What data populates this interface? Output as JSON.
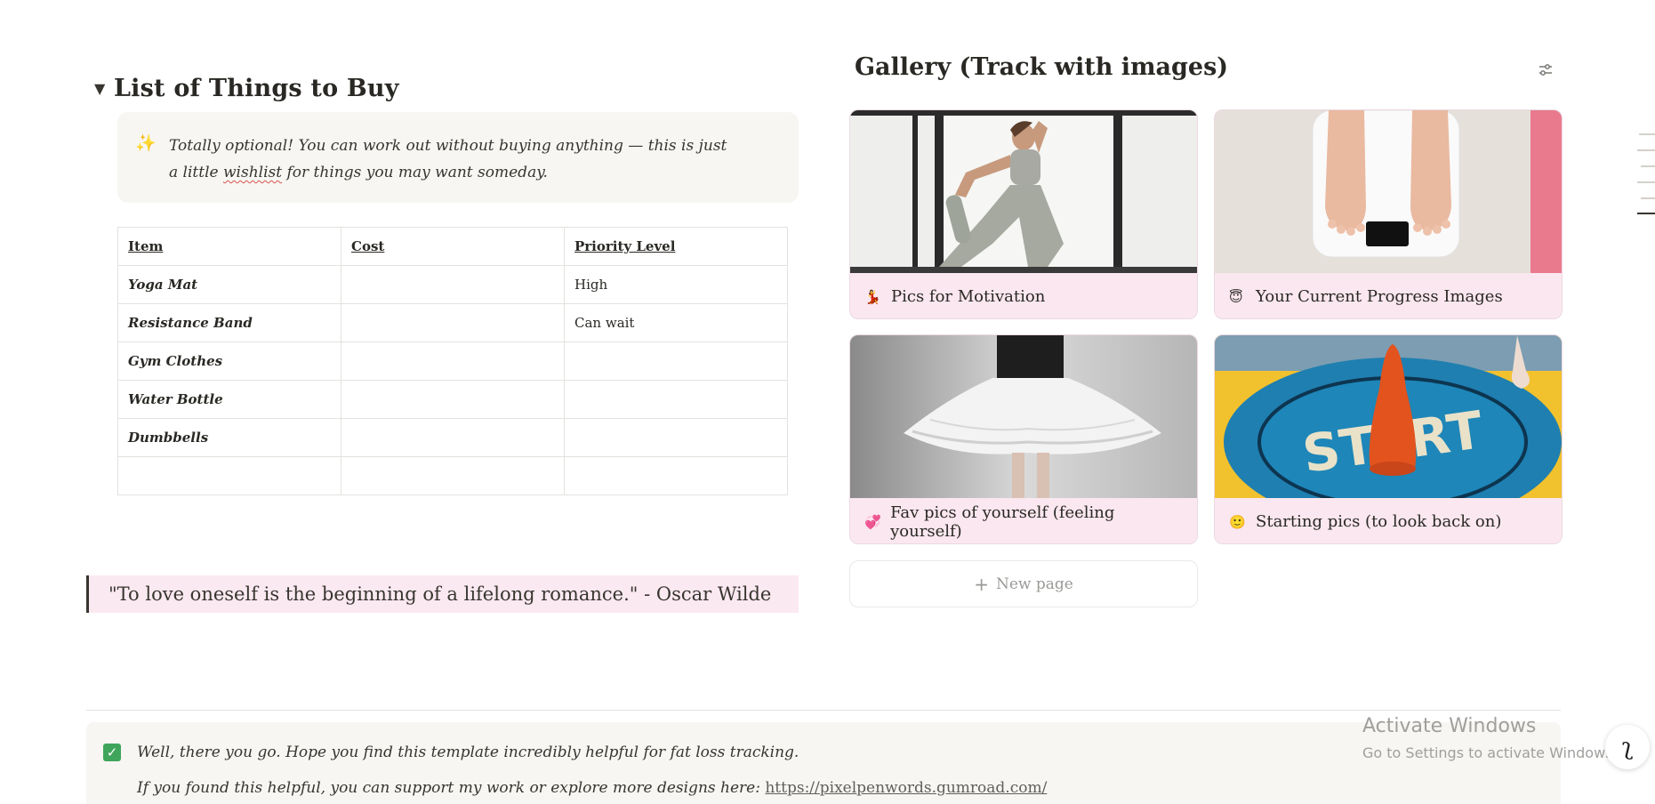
{
  "buy_list": {
    "heading": "List of Things to Buy",
    "callout": {
      "icon": "sparkles-icon",
      "text_before": "Totally optional! You can work out without buying anything — this is just a little ",
      "text_squiggle": "wishlist",
      "text_after": " for things you may want someday."
    },
    "table": {
      "headers": [
        "Item",
        "Cost",
        "Priority Level"
      ],
      "rows": [
        [
          "Yoga Mat",
          "",
          "High"
        ],
        [
          "Resistance Band",
          "",
          "Can wait"
        ],
        [
          "Gym Clothes",
          "",
          ""
        ],
        [
          "Water Bottle",
          "",
          ""
        ],
        [
          "Dumbbells",
          "",
          ""
        ],
        [
          "",
          "",
          ""
        ]
      ]
    }
  },
  "quote": "\"To love oneself is the beginning of a lifelong romance.\" - Oscar Wilde",
  "gallery": {
    "title": "Gallery (Track with images)",
    "cards": [
      {
        "emoji": "💃",
        "title": "Pics for Motivation"
      },
      {
        "emoji": "😇",
        "title": "Your Current Progress Images"
      },
      {
        "emoji": "💞",
        "title": "Fav pics of yourself (feeling yourself)"
      },
      {
        "emoji": "🙂",
        "title": "Starting pics (to look back on)"
      }
    ],
    "new_page_label": "New page"
  },
  "footer_callout": {
    "line1": "Well, there you go. Hope you find this template incredibly helpful for fat loss tracking.",
    "line2": "If you found this helpful, you can support my work or explore more designs here: ",
    "link": "https://pixelpenwords.gumroad.com/"
  },
  "watermark": {
    "title": "Activate Windows",
    "subtitle": "Go to Settings to activate Windows."
  },
  "colors": {
    "callout_bg": "#f7f6f3",
    "card_caption_bg": "#fae7ef",
    "quote_bg": "#fbe9f1",
    "check_green": "#3fa55b"
  }
}
